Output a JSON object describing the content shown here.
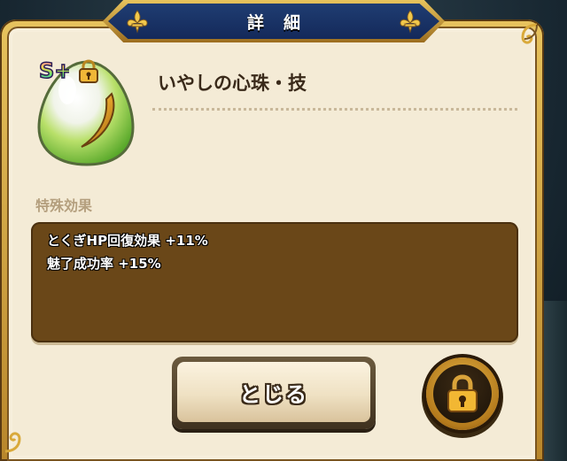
{
  "dialog": {
    "title": "詳細",
    "item_name": "いやしの心珠・技",
    "rank_badge": "S+",
    "section_label": "特殊効果",
    "effects": [
      "とくぎHP回復効果 +11%",
      "魅了成功率 +15%"
    ],
    "close_label": "とじる",
    "icons": {
      "item": "orb-egg-icon",
      "rank": "rank-badge-icon",
      "lock_small": "lock-icon",
      "lock_button": "lock-icon",
      "ornament": "fleur-de-lis-icon"
    }
  },
  "colors": {
    "panel_bg": "#f4ebd6",
    "frame_gold": "#e7c35e",
    "banner_blue": "#1f3d72",
    "effects_bg": "#6a4718",
    "label_tan": "#b49f7e"
  }
}
